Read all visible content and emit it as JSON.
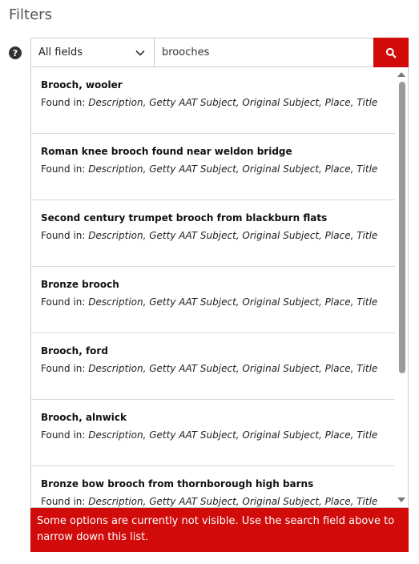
{
  "header": {
    "title": "Filters"
  },
  "help": {
    "glyph": "?"
  },
  "search": {
    "field_select": "All fields",
    "query": "brooches",
    "button_icon": "search-icon"
  },
  "results": [
    {
      "title": "Brooch, wooler",
      "found_label": "Found in: ",
      "fields": "Description, Getty AAT Subject, Original Subject, Place, Title"
    },
    {
      "title": "Roman knee brooch found near weldon bridge",
      "found_label": "Found in: ",
      "fields": "Description, Getty AAT Subject, Original Subject, Place, Title"
    },
    {
      "title": "Second century trumpet brooch from blackburn flats",
      "found_label": "Found in: ",
      "fields": "Description, Getty AAT Subject, Original Subject, Place, Title"
    },
    {
      "title": "Bronze brooch",
      "found_label": "Found in: ",
      "fields": "Description, Getty AAT Subject, Original Subject, Place, Title"
    },
    {
      "title": "Brooch, ford",
      "found_label": "Found in: ",
      "fields": "Description, Getty AAT Subject, Original Subject, Place, Title"
    },
    {
      "title": "Brooch, alnwick",
      "found_label": "Found in: ",
      "fields": "Description, Getty AAT Subject, Original Subject, Place, Title"
    },
    {
      "title": "Bronze bow brooch from thornborough high barns",
      "found_label": "Found in: ",
      "fields": "Description, Getty AAT Subject, Original Subject, Place, Title"
    }
  ],
  "notice": {
    "text": "Some options are currently not visible. Use the search field above to narrow down this list."
  },
  "colors": {
    "accent": "#d10a0a",
    "border": "#cccccc"
  }
}
